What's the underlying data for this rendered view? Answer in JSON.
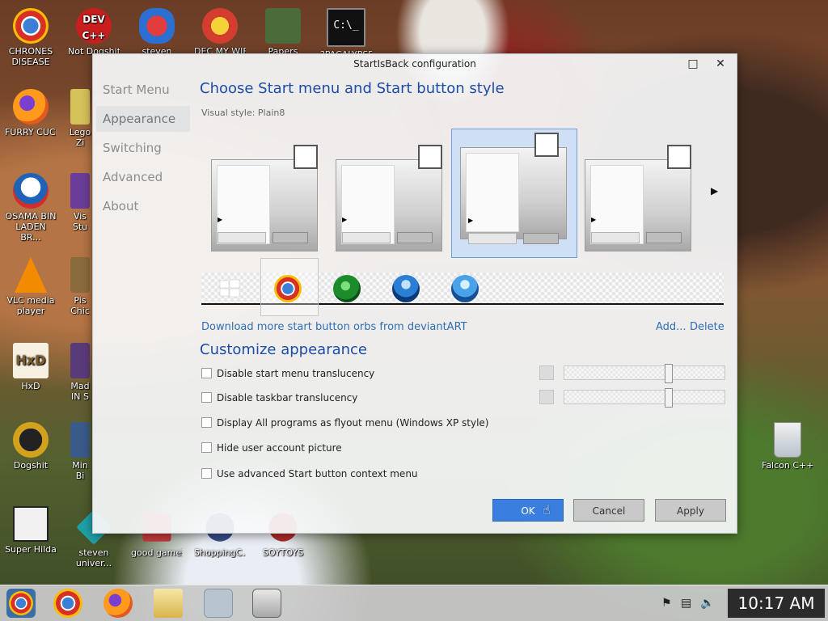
{
  "desktop_icons": [
    {
      "label": "CHRONES DISEASE",
      "icon": "chrome-icon",
      "color": "#3b7fd6"
    },
    {
      "label": "Not Dogshit",
      "icon": "devcpp-icon",
      "color": "#c81e1e"
    },
    {
      "label": "steven",
      "icon": "steven-icon",
      "color": "#c8292a"
    },
    {
      "label": "DEC MY WIFEL",
      "icon": "game-icon",
      "color": "#d43c2f"
    },
    {
      "label": "Papers",
      "icon": "papers-icon",
      "color": "#4b6b3b"
    },
    {
      "label": "?PACALYPSE",
      "icon": "cmd-icon",
      "color": "#111111"
    },
    {
      "label": "FURRY CUCKS",
      "icon": "firefox-icon",
      "color": "#e66b1d"
    },
    {
      "label": "Lego Zi",
      "icon": "lego-icon",
      "color": "#d4c25a"
    },
    {
      "label": "OSAMA BIN LADEN BR...",
      "icon": "obama-logo-icon",
      "color": "#1f63b6"
    },
    {
      "label": "Vis Stu",
      "icon": "visual-studio-icon",
      "color": "#6a3d9a"
    },
    {
      "label": "VLC media player",
      "icon": "vlc-icon",
      "color": "#f28b00"
    },
    {
      "label": "Pis Chic",
      "icon": "game-icon-2",
      "color": "#8a6b3d"
    },
    {
      "label": "HxD",
      "icon": "hxd-icon",
      "color": "#c9b073"
    },
    {
      "label": "Mad IN S",
      "icon": "game-icon-3",
      "color": "#5a3b7a"
    },
    {
      "label": "Dogshit",
      "icon": "code-icon",
      "color": "#d2a21e"
    },
    {
      "label": "Min Bi",
      "icon": "game-icon-4",
      "color": "#3a5a8a"
    },
    {
      "label": "Super Hilda",
      "icon": "dog-icon",
      "color": "#f0f0f0"
    },
    {
      "label": "steven univer...",
      "icon": "steven-universe-icon",
      "color": "#1fa0a8"
    },
    {
      "label": "good game2",
      "icon": "game-icon-5",
      "color": "#c43a3a"
    },
    {
      "label": "ShoppingC...",
      "icon": "shopping-icon",
      "color": "#3a4b8a"
    },
    {
      "label": "SOYTOYS",
      "icon": "soy-icon",
      "color": "#b02a2a"
    },
    {
      "label": "Falcon C++",
      "icon": "recycle-bin-icon",
      "color": "#cfd6de"
    }
  ],
  "dialog": {
    "title": "StartIsBack configuration",
    "nav": [
      "Start Menu",
      "Appearance",
      "Switching",
      "Advanced",
      "About"
    ],
    "heading_style": "Choose Start menu and Start button style",
    "visual_style_label": "Visual style:",
    "visual_style_value": "Plain8",
    "deviantart_link": "Download more start button orbs from deviantART",
    "add_link": "Add...",
    "delete_link": "Delete",
    "heading_customize": "Customize appearance",
    "options": [
      "Disable start menu translucency",
      "Disable taskbar translucency",
      "Display All programs as flyout menu (Windows XP style)",
      "Hide user account picture",
      "Use advanced Start button context menu"
    ],
    "ok": "OK",
    "cancel": "Cancel",
    "apply": "Apply"
  },
  "taskbar": {
    "clock": "10:17 AM"
  },
  "colors": {
    "accent": "#1c4da8",
    "link": "#2f6fb5",
    "ok_button": "#3a7fe0"
  }
}
